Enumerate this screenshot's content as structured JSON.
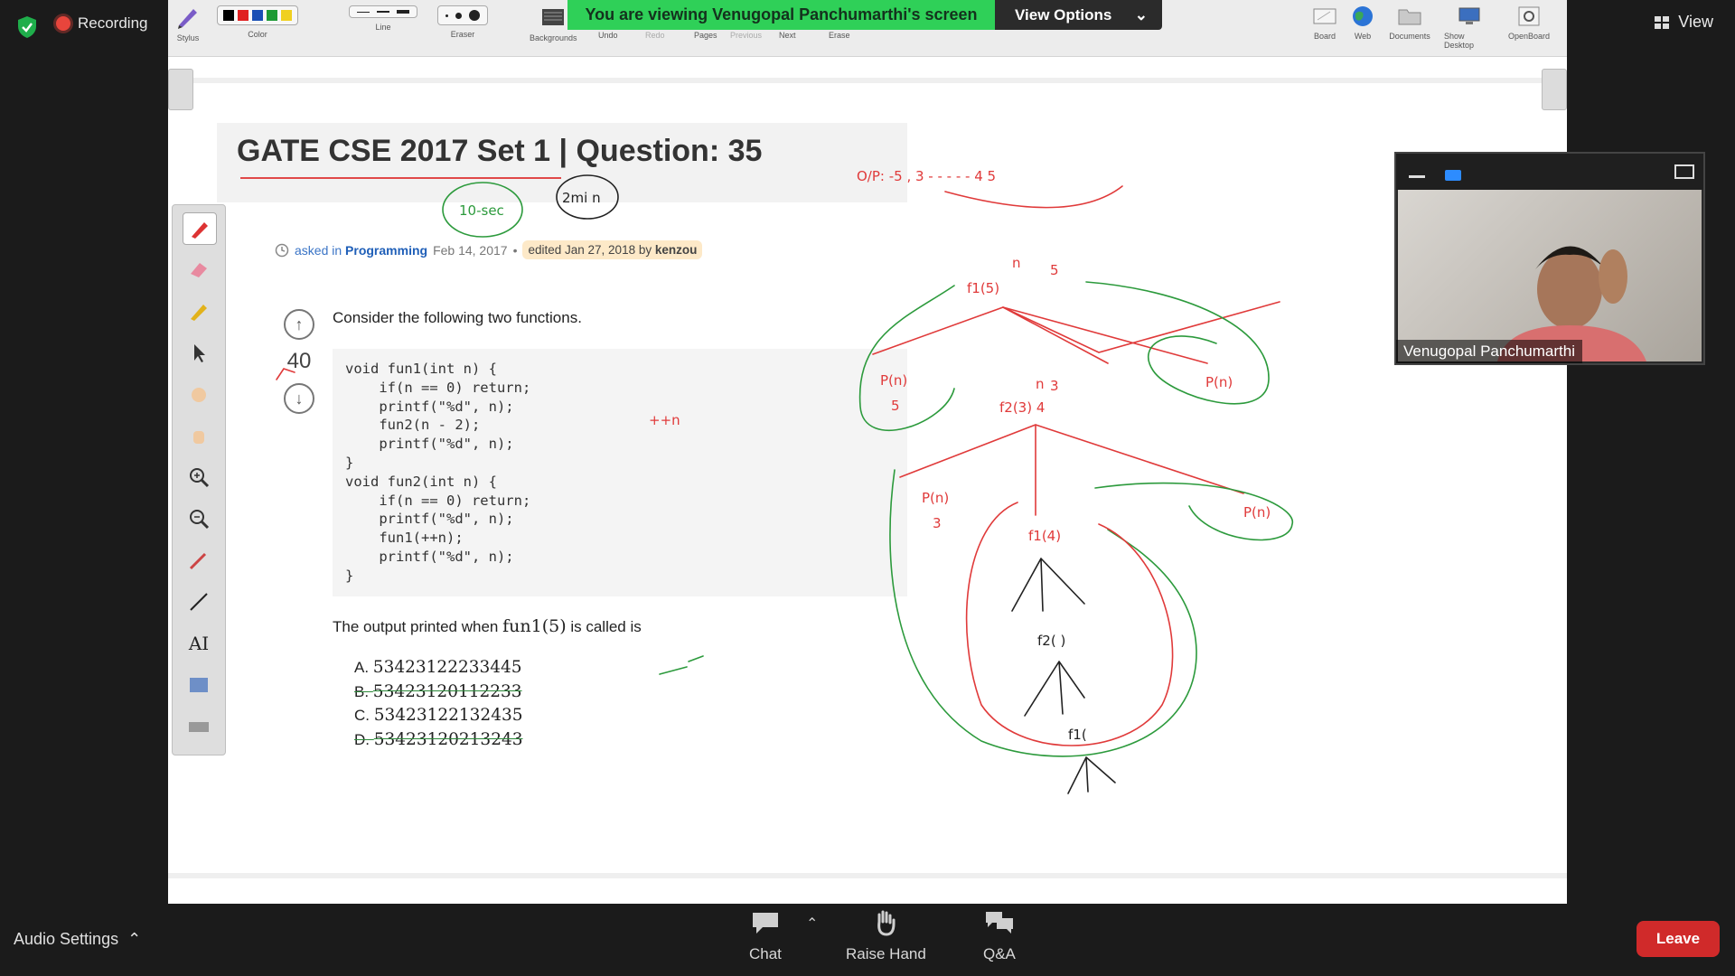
{
  "zoom": {
    "recording_label": "Recording",
    "view_label": "View",
    "banner_text": "You are viewing Venugopal Panchumarthi's screen",
    "view_options_label": "View Options",
    "audio_settings_label": "Audio Settings",
    "chat_label": "Chat",
    "raise_hand_label": "Raise Hand",
    "qa_label": "Q&A",
    "leave_label": "Leave",
    "participant_name": "Venugopal Panchumarthi"
  },
  "whiteboard_toolbar": {
    "stylus": "Stylus",
    "color": "Color",
    "line": "Line",
    "eraser": "Eraser",
    "backgrounds": "Backgrounds",
    "undo": "Undo",
    "redo": "Redo",
    "pages": "Pages",
    "previous": "Previous",
    "next": "Next",
    "erase": "Erase",
    "board": "Board",
    "web": "Web",
    "documents": "Documents",
    "show_desktop": "Show Desktop",
    "openboard": "OpenBoard",
    "colors": [
      "#000000",
      "#e02020",
      "#1a4fb5",
      "#1d9a35",
      "#f0d020"
    ]
  },
  "question": {
    "title": "GATE CSE 2017 Set 1 | Question: 35",
    "asked_in": "asked in",
    "category": "Programming",
    "date": "Feb 14, 2017",
    "edited_prefix": "edited Jan 27, 2018 by",
    "editor": "kenzou",
    "votes": "40",
    "intro": "Consider the following two functions.",
    "code": "void fun1(int n) {\n    if(n == 0) return;\n    printf(\"%d\", n);\n    fun2(n - 2);\n    printf(\"%d\", n);\n}\nvoid fun2(int n) {\n    if(n == 0) return;\n    printf(\"%d\", n);\n    fun1(++n);\n    printf(\"%d\", n);\n}",
    "output_prefix": "The output printed when",
    "output_call": "fun1(5)",
    "output_suffix": "is called is",
    "options": [
      {
        "letter": "A.",
        "value": "53423122233445"
      },
      {
        "letter": "B.",
        "value": "53423120112233"
      },
      {
        "letter": "C.",
        "value": "53423122132435"
      },
      {
        "letter": "D.",
        "value": "53423120213243"
      }
    ]
  },
  "annotations": {
    "time_note": "10-sec",
    "min_note": "2mi n",
    "op_note": "O/P: -5 , 3 - - - - - 4   5",
    "plus_note": "++n",
    "tree_f1_5": "f1(5)",
    "tree_n_top": "n",
    "tree_5_box": "5",
    "tree_pn_left": "P(n)",
    "tree_5_left": "5",
    "tree_pn_right": "P(n)",
    "tree_f2_3": "f2(3) 4",
    "tree_n_mid": "n",
    "tree_3_box": "3",
    "tree_pn_3": "P(n)",
    "tree_3": "3",
    "tree_pn_r2": "P(n)",
    "tree_f1_4": "f1(4)",
    "tree_f2_blank": "f2( )",
    "tree_f1_blank": "f1("
  }
}
